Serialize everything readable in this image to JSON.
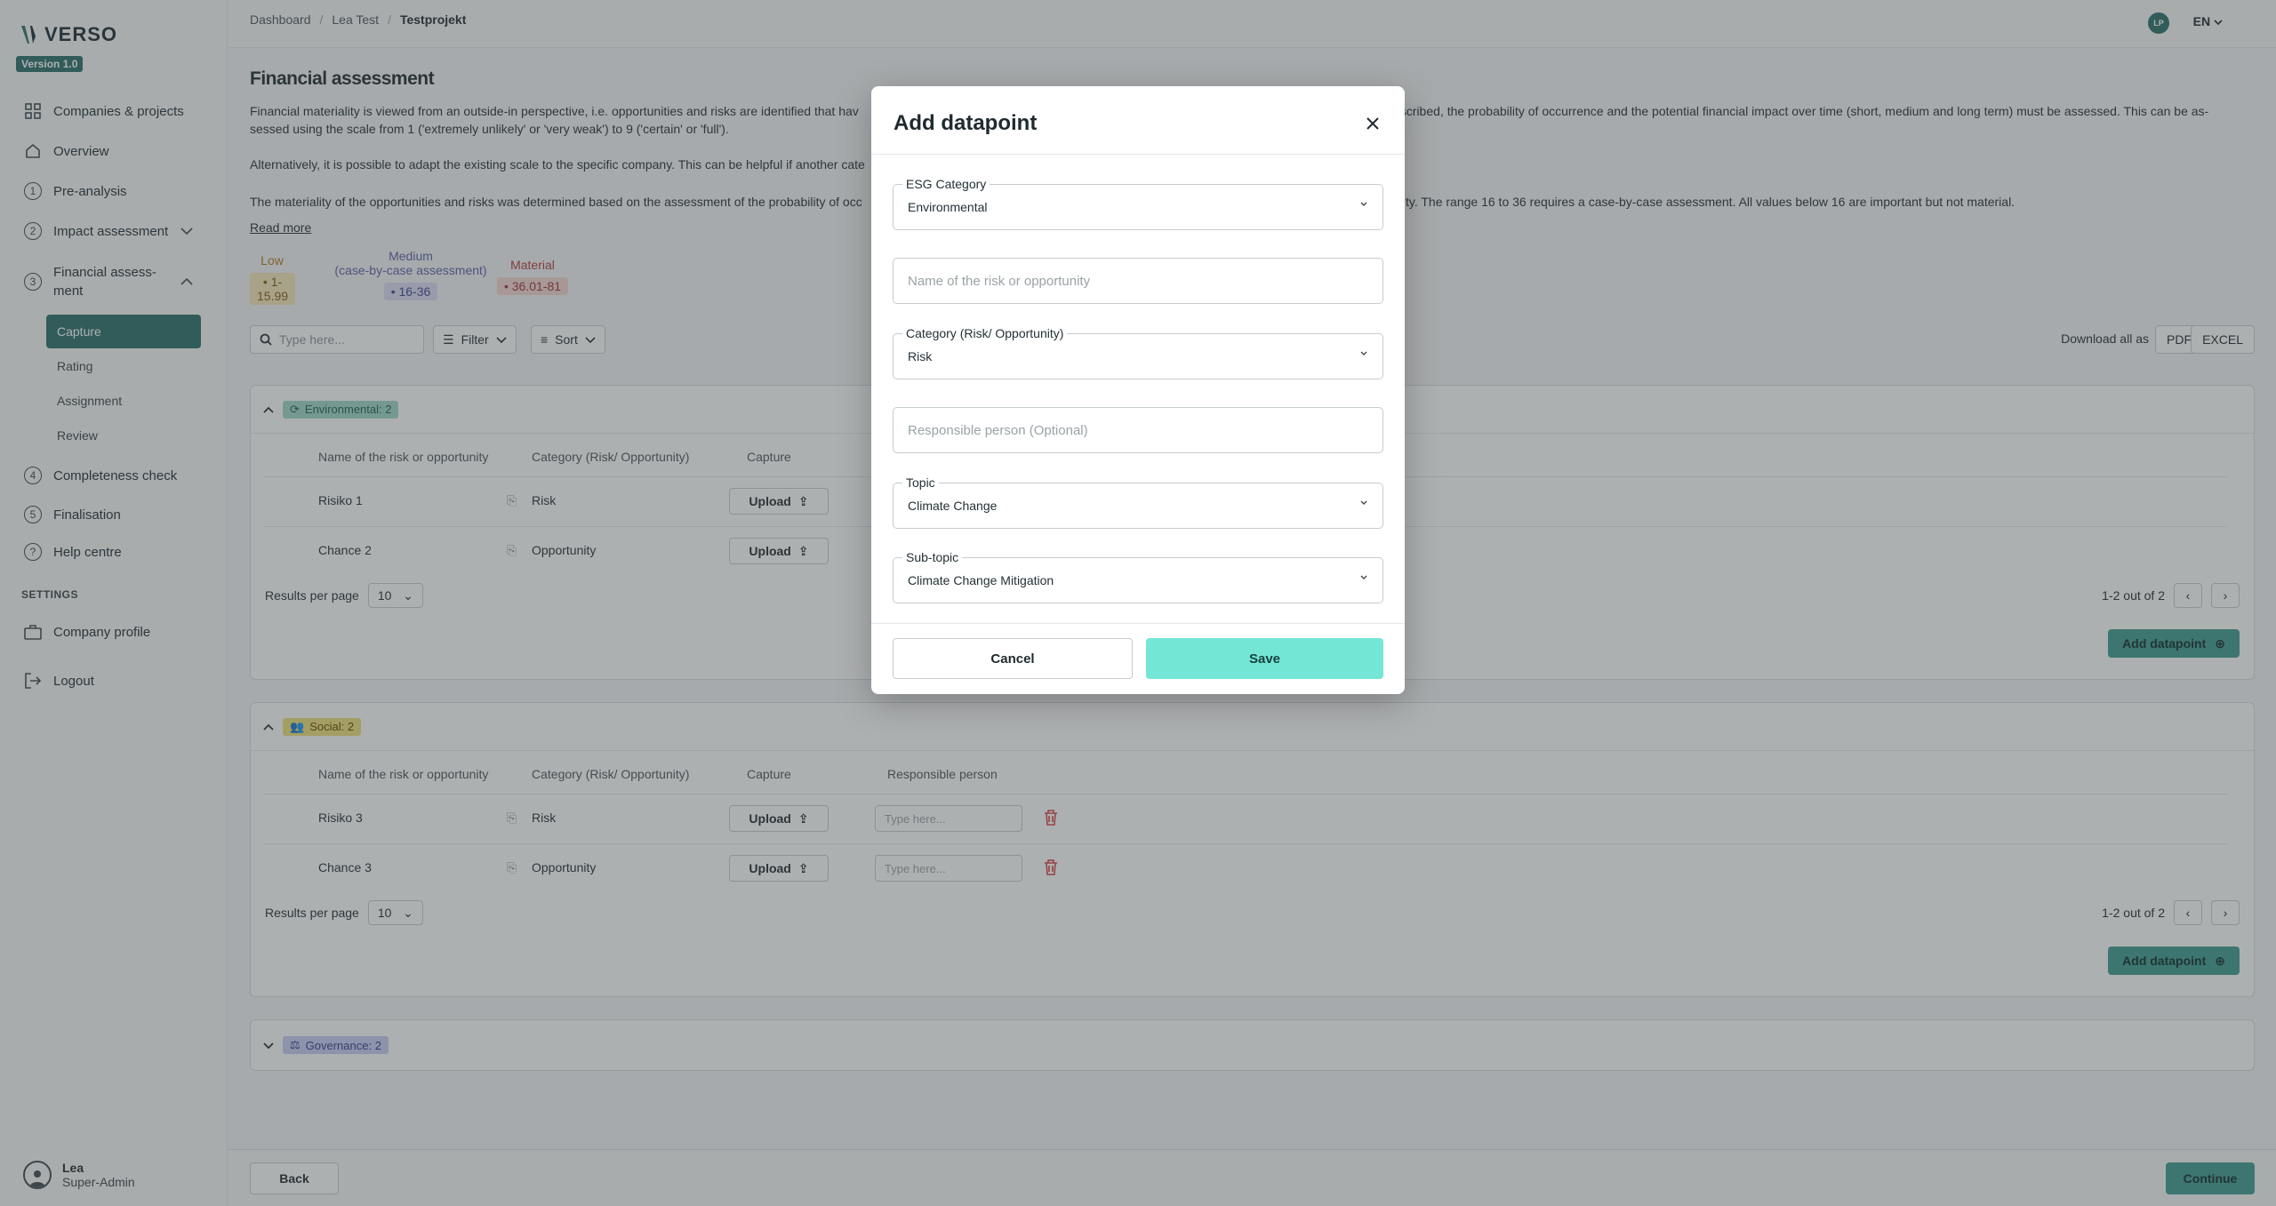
{
  "app": {
    "name": "VERSO",
    "version": "Version 1.0"
  },
  "sidebar": {
    "items": [
      {
        "label": "Companies & projects"
      },
      {
        "label": "Overview"
      },
      {
        "label": "Pre-analysis",
        "num": "1"
      },
      {
        "label": "Impact assessment",
        "num": "2"
      },
      {
        "label": "Financial assess-\nment",
        "label1": "Financial assess-",
        "label2": "ment",
        "num": "3"
      },
      {
        "label": "Completeness check",
        "num": "4"
      },
      {
        "label": "Finalisation",
        "num": "5"
      },
      {
        "label": "Help centre"
      }
    ],
    "sub_items": [
      "Capture",
      "Rating",
      "Assignment",
      "Review"
    ],
    "settings_heading": "SETTINGS",
    "settings_items": [
      "Company profile",
      "Logout"
    ],
    "user": {
      "name": "Lea",
      "role": "Super-Admin"
    }
  },
  "header": {
    "breadcrumb": [
      "Dashboard",
      "Lea Test",
      "Testprojekt"
    ],
    "avatar_initials": "LP",
    "language": "EN"
  },
  "main": {
    "title": "Financial assessment",
    "para1_line1": "Financial materiality is viewed from an outside-in perspective, i.e. opportunities and risks are identified that hav",
    "para1_line1_right": "escribed, the probability of occurrence and the potential financial impact over time (short, medium and long term) must be assessed. This can be as-",
    "para1_line2": "sessed using the scale from 1 ('extremely unlikely' or 'very weak') to 9 ('certain' or 'full').",
    "para2": "Alternatively, it is possible to adapt the existing scale to the specific company. This can be helpful if another cate",
    "para3_left": "The materiality of the opportunities and risks was determined based on the assessment of the probability of occ",
    "para3_right": "ality. The range 16 to 36 requires a case-by-case assessment. All values below 16 are important but not material.",
    "read_more": "Read more",
    "legend": [
      {
        "label": "Low",
        "range": "1-15.99",
        "color": "#b07a1f",
        "bg": "#f5e7b8"
      },
      {
        "label": "Medium\n(case-by-case assessment)",
        "label1": "Medium",
        "label2": "(case-by-case assessment)",
        "range": "16-36",
        "color": "#5a5fa8",
        "bg": "#d9dbf3"
      },
      {
        "label": "Material",
        "range": "36.01-81",
        "color": "#b03b3b",
        "bg": "#f4d6d2"
      }
    ],
    "search_placeholder": "Type here...",
    "filter_label": "Filter",
    "sort_label": "Sort",
    "download_label": "Download all as",
    "pdf_label": "PDF",
    "excel_label": "EXCEL",
    "columns": [
      "Name of the risk or opportunity",
      "Category (Risk/ Opportunity)",
      "Capture",
      "Responsible person"
    ],
    "sections": [
      {
        "tag": "Environmental: 2",
        "rows": [
          {
            "name": "Risiko 1",
            "category": "Risk"
          },
          {
            "name": "Chance 2",
            "category": "Opportunity"
          }
        ],
        "results_per_page": "Results per page",
        "rpp_value": "10",
        "pager_text": "1-2 out of 2",
        "add_label": "Add datapoint"
      },
      {
        "tag": "Social: 2",
        "rows": [
          {
            "name": "Risiko 3",
            "category": "Risk"
          },
          {
            "name": "Chance 3",
            "category": "Opportunity"
          }
        ],
        "results_per_page": "Results per page",
        "rpp_value": "10",
        "pager_text": "1-2 out of 2",
        "add_label": "Add datapoint"
      },
      {
        "tag": "Governance: 2"
      }
    ],
    "upload_label": "Upload",
    "resp_placeholder": "Type here..."
  },
  "footer": {
    "back_label": "Back",
    "continue_label": "Continue"
  },
  "modal": {
    "title": "Add datapoint",
    "esg_label": "ESG Category",
    "esg_value": "Environmental",
    "name_placeholder": "Name of the risk or opportunity",
    "category_label": "Category (Risk/ Opportunity)",
    "category_value": "Risk",
    "responsible_placeholder": "Responsible person (Optional)",
    "topic_label": "Topic",
    "topic_value": "Climate Change",
    "subtopic_label": "Sub-topic",
    "subtopic_value": "Climate Change Mitigation",
    "cancel_label": "Cancel",
    "save_label": "Save"
  },
  "colors": {
    "accent": "#2a6f68",
    "button": "#3e9b8f",
    "save": "#74e6d6",
    "danger": "#d64545"
  }
}
